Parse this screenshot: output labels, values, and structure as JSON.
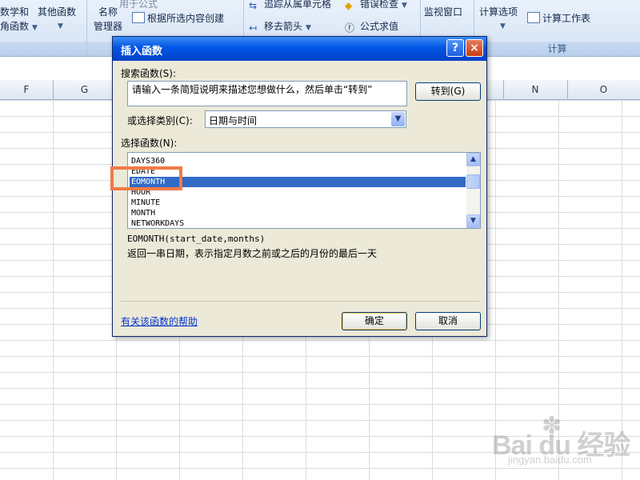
{
  "ribbon": {
    "group1_line1": "数学和",
    "group1_line2": "角函数",
    "other_functions": "其他函数",
    "name_manager_line1": "名称",
    "name_manager_line2": "管理器",
    "use_in_formula": "用于公式",
    "create_from_selection": "根据所选内容创建",
    "trace_dependents": "追踪从属单元格",
    "remove_arrows": "移去箭头",
    "error_checking": "错误检查",
    "evaluate_formula": "公式求值",
    "watch_window": "监视窗口",
    "calc_options": "计算选项",
    "calc_now": "计算工作表",
    "calc_group_label": "计算"
  },
  "sheet": {
    "columns": [
      "F",
      "G",
      "N",
      "O"
    ]
  },
  "dialog": {
    "title": "插入函数",
    "help_icon": "?",
    "close_icon": "×",
    "search_label": "搜索函数(S):",
    "search_placeholder": "请输入一条简短说明来描述您想做什么，然后单击“转到”",
    "go_button": "转到(G)",
    "category_label": "或选择类别(C):",
    "category_value": "日期与时间",
    "select_label": "选择函数(N):",
    "functions": [
      "DAYS360",
      "EDATE",
      "EOMONTH",
      "HOUR",
      "MINUTE",
      "MONTH",
      "NETWORKDAYS"
    ],
    "selected_function": "EOMONTH",
    "signature": "EOMONTH(start_date,months)",
    "description": "返回一串日期，表示指定月数之前或之后的月份的最后一天",
    "help_link": "有关该函数的帮助",
    "ok_button": "确定",
    "cancel_button": "取消"
  },
  "watermark": {
    "brand": "Bai du 经验",
    "url": "jingyan.baidu.com"
  }
}
